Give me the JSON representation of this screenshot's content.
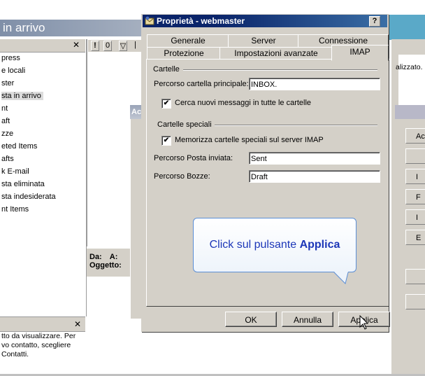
{
  "background_app": {
    "title": "in arrivo",
    "folders": [
      "press",
      "e locali",
      "ster",
      "sta in arrivo",
      "nt",
      "aft",
      "zze",
      "eted Items",
      "afts",
      "k E-mail",
      "sta eliminata",
      "sta indesiderata",
      "nt Items"
    ],
    "selected_folder_index": 3,
    "toolbar_icons": [
      "!",
      "0",
      "▽",
      "|"
    ],
    "preview_from_label": "Da:",
    "preview_to_label": "A:",
    "preview_subject_label": "Oggetto:",
    "right_text": "alizzato.",
    "contacts_text": [
      "tto da visualizzare. Per",
      "vo contatto, scegliere",
      "Contatti."
    ],
    "second_dialog_title": "Ac",
    "right_buttons": [
      "Ac",
      "",
      "I",
      "F",
      "I",
      "E",
      "",
      ""
    ],
    "close_glyph": "✕"
  },
  "dialog": {
    "title": "Proprietà - webmaster",
    "help_label": "?",
    "tabs_row1": [
      "Generale",
      "Server",
      "Connessione"
    ],
    "tabs_row2": [
      "Protezione",
      "Impostazioni avanzate",
      "IMAP"
    ],
    "active_tab": "IMAP",
    "group_folders": "Cartelle",
    "root_path_label": "Percorso cartella principale:",
    "root_path_value": "INBOX.",
    "check_new_label": "Cerca nuovi messaggi in tutte le cartelle",
    "check_new_checked": true,
    "group_special": "Cartelle speciali",
    "store_special_label": "Memorizza cartelle speciali sul server IMAP",
    "store_special_checked": true,
    "sent_label": "Percorso Posta inviata:",
    "sent_value": "Sent",
    "drafts_label": "Percorso Bozze:",
    "drafts_value": "Draft",
    "ok_label": "OK",
    "cancel_label": "Annulla",
    "apply_label": "Applica",
    "checkmark": "✔"
  },
  "callout": {
    "text": "Click sul pulsante ",
    "emphasis": "Applica"
  },
  "colors": {
    "title_bar": "#0a246a",
    "dialog_face": "#d4d0c8",
    "callout_text": "#1c36b8",
    "callout_border": "#5b8ed6"
  }
}
